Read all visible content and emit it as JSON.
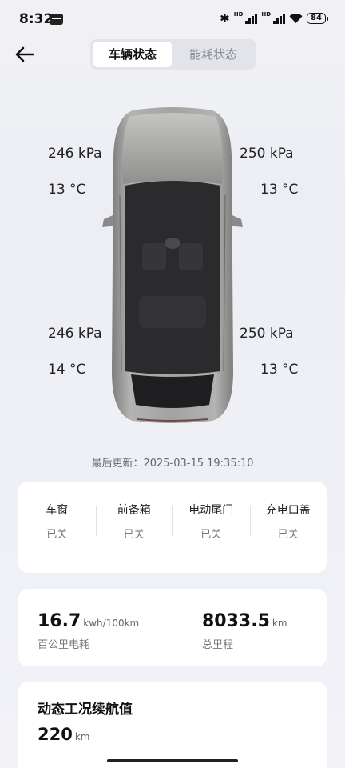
{
  "status": {
    "time": "8:32",
    "battery": "84"
  },
  "tabs": [
    {
      "label": "车辆状态"
    },
    {
      "label": "能耗状态"
    }
  ],
  "tires": {
    "front_left": {
      "pressure": "246 kPa",
      "temp": "13 °C"
    },
    "front_right": {
      "pressure": "250 kPa",
      "temp": "13 °C"
    },
    "rear_left": {
      "pressure": "246 kPa",
      "temp": "14 °C"
    },
    "rear_right": {
      "pressure": "250 kPa",
      "temp": "13 °C"
    }
  },
  "last_updated": "最后更新：2025-03-15 19:35:10",
  "closures": [
    {
      "label": "车窗",
      "state": "已关"
    },
    {
      "label": "前备箱",
      "state": "已关"
    },
    {
      "label": "电动尾门",
      "state": "已关"
    },
    {
      "label": "充电口盖",
      "state": "已关"
    }
  ],
  "energy": {
    "consumption": {
      "value": "16.7",
      "unit": "kwh/100km",
      "label": "百公里电耗"
    },
    "odometer": {
      "value": "8033.5",
      "unit": "km",
      "label": "总里程"
    }
  },
  "range": {
    "title": "动态工况续航值",
    "value": "220",
    "unit": "km"
  },
  "colors": {
    "accent": "#111111",
    "car_body": "#9a9b99",
    "glass": "#2a2a2c"
  }
}
